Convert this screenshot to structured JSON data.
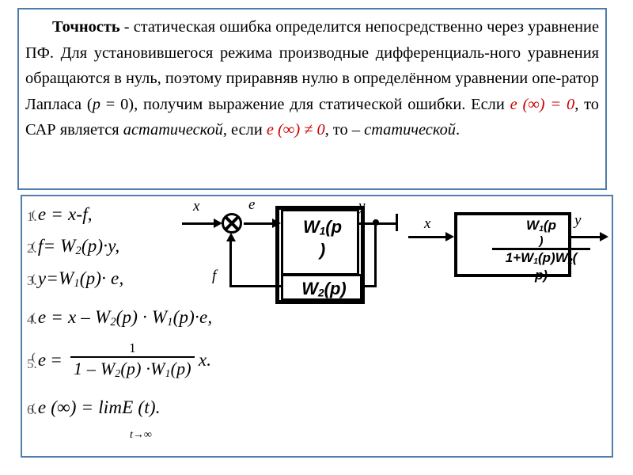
{
  "theme": {
    "frame_color": "#4f7caa",
    "accent_red": "#cc0000",
    "text_color": "#000000",
    "background": "#ffffff"
  },
  "text_panel": {
    "paragraph_plain": "Точность - статическая ошибка определится непосредственно через уравнение ПФ. Для установившегося режима производные дифференциаль-ного уравнения обращаются в нуль, поэтому приравняв нулю в определённом уравнении опе-ратор Лапласа (p = 0), получим выражение для статической ошибки. Если e (∞) = 0, то САР является астатической, если e (∞) ≠ 0, то – статической.",
    "segments": {
      "bold_term": "Точность",
      "dash": " - ",
      "run1": "статическая ошибка определится непосредственно через уравнение ПФ. Для установившегося режима производные дифференциаль-ного уравнения обращаются в нуль, поэтому приравняв нулю в определённом уравнении опе-ратор Лапласа (",
      "p_italic": "p",
      "run2": " = 0), получим выражение для статической ошибки. Если ",
      "red_zero_cond": "e (∞) = 0",
      "run3": ", то САР является ",
      "italic_astatic": "астатической",
      "run4": ", если ",
      "red_nonzero_cond": "e (∞) ≠ 0",
      "run5": ", то – ",
      "italic_static": "статической",
      "period": "."
    }
  },
  "formulas": {
    "items": [
      {
        "id": "eq1",
        "text": "e = x-f,",
        "ghost_number": "1."
      },
      {
        "id": "eq2",
        "text": "f= W2(p)·y,",
        "ghost_number": "2."
      },
      {
        "id": "eq3",
        "text": "y=W1(p)· e,",
        "ghost_number": "3."
      },
      {
        "id": "eq4",
        "text": "e = x – W2(p) ·W1(p)·e,",
        "ghost_number": "4."
      },
      {
        "id": "eq5",
        "text": "e = 1 / (1 – W2(p) ·W1(p)) x.",
        "ghost_number": "5."
      },
      {
        "id": "eq6",
        "text": "e (∞) = limE (t).",
        "ghost_number": "6."
      }
    ],
    "eq1": {
      "lhs": "e",
      "eq": "=",
      "rhs": "x-f,"
    },
    "eq2": {
      "lhs": "f",
      "eq": "=",
      "w": "W",
      "wsub": "2",
      "rest": "(p)·y,"
    },
    "eq3": {
      "lhs": "y",
      "eq": "=",
      "w": "W",
      "wsub": "1",
      "rest": "(p)· e,"
    },
    "eq4": {
      "lhs": "e",
      "eq": "=",
      "x": "x –",
      "w2": "W",
      "w2sub": "2",
      "mid": "(p) ·",
      "w1": "W",
      "w1sub": "1",
      "rest": "(p)·e,"
    },
    "eq5": {
      "lhs": "e",
      "eq": "=",
      "numerator": "1",
      "denominator_pre": "1 –  W",
      "den_sub2": "2",
      "den_mid": "(p) ·W",
      "den_sub1": "1",
      "den_post": "(p)",
      "tail": "x."
    },
    "eq6": {
      "lhs": "e (∞)",
      "eq": "=",
      "rhs": "limE (t).",
      "limit_sub": "t→∞"
    }
  },
  "diagram_feedback": {
    "caption_labels": {
      "input": "x",
      "error": "e",
      "output": "y",
      "feedback": "f"
    },
    "blocks": [
      {
        "name": "forward-block",
        "label_main": "W",
        "label_sub": "1",
        "label_tail": "(p",
        "label_wrap": ")"
      },
      {
        "name": "feedback-block",
        "label_main": "W",
        "label_sub": "2",
        "label_tail": "(p)"
      }
    ],
    "summing_node": "x-circle-sum"
  },
  "diagram_closedloop": {
    "labels": {
      "input": "x",
      "output": "y"
    },
    "transfer_function": {
      "numerator_main": "W",
      "numerator_sub": "1",
      "numerator_tail": "(p",
      "numerator_wrap": ")",
      "denominator_pre": "1+W",
      "denominator_sub1": "1",
      "denominator_mid": "(p)W",
      "denominator_sub2": "2",
      "denominator_tail": "(",
      "denominator_wrap": "p)"
    }
  }
}
